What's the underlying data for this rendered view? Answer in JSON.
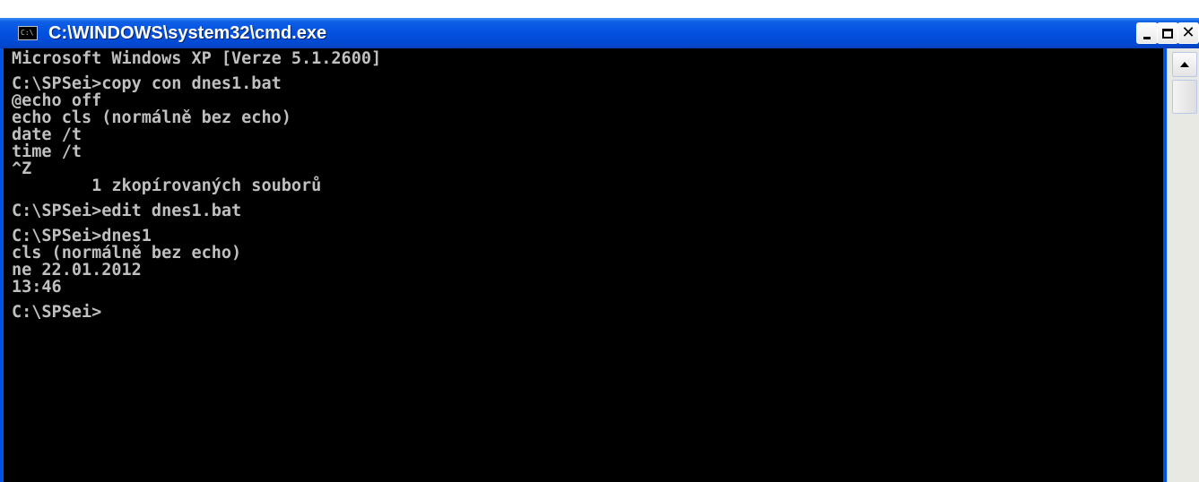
{
  "window": {
    "title": "C:\\WINDOWS\\system32\\cmd.exe",
    "icon": "cmd-icon",
    "icon_text": "C:\\",
    "controls": [
      "minimize-icon",
      "maximize-icon",
      "close-icon"
    ]
  },
  "console": {
    "lines": [
      "Microsoft Windows XP [Verze 5.1.2600]",
      "",
      "C:\\SPSei>copy con dnes1.bat",
      "@echo off",
      "echo cls (normálně bez echo)",
      "date /t",
      "time /t",
      "^Z",
      "        1 zkopírovaných souborů",
      "",
      "C:\\SPSei>edit dnes1.bat",
      "",
      "C:\\SPSei>dnes1",
      "cls (normálně bez echo)",
      "ne 22.01.2012",
      "13:46",
      "",
      "C:\\SPSei>"
    ]
  },
  "colors": {
    "titlebar": "#0054e3",
    "console_bg": "#000000",
    "console_text": "#c0c0c0"
  }
}
